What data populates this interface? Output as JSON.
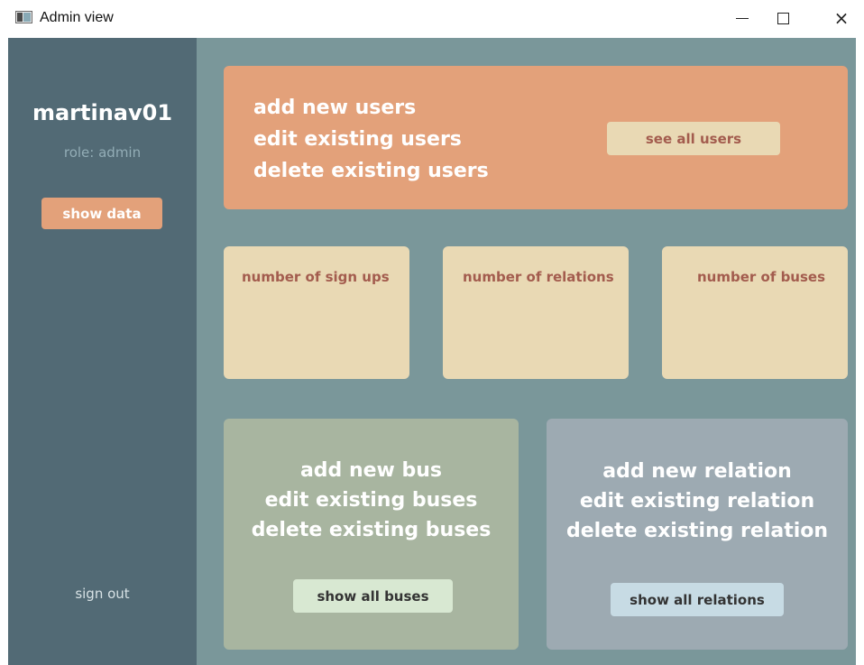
{
  "window": {
    "title": "Admin view",
    "icon": "app-window-icon",
    "controls": {
      "minimize": "minimize-icon",
      "maximize": "maximize-icon",
      "close": "×"
    }
  },
  "sidebar": {
    "username": "martinav01",
    "role": "role: admin",
    "show_data_label": "show data",
    "sign_out_label": "sign out"
  },
  "users_panel": {
    "lines": [
      "add new users",
      "edit existing users",
      "delete existing users"
    ],
    "button_label": "see all users"
  },
  "stats": [
    {
      "label": "number of sign ups"
    },
    {
      "label": "number of relations"
    },
    {
      "label": "number of buses"
    }
  ],
  "buses_panel": {
    "lines": [
      "add new bus",
      "edit existing buses",
      "delete existing buses"
    ],
    "button_label": "show all buses"
  },
  "relations_panel": {
    "lines": [
      "add new relation",
      "edit existing relation",
      "delete existing relation"
    ],
    "button_label": "show all relations"
  },
  "colors": {
    "sidebar": "#526a75",
    "content_bg": "#7a979a",
    "accent_orange": "#e3a17a",
    "cream": "#e9d9b4",
    "text_brown": "#a35c4e",
    "bus_card": "#a8b5a0",
    "relation_card": "#9daab2"
  }
}
